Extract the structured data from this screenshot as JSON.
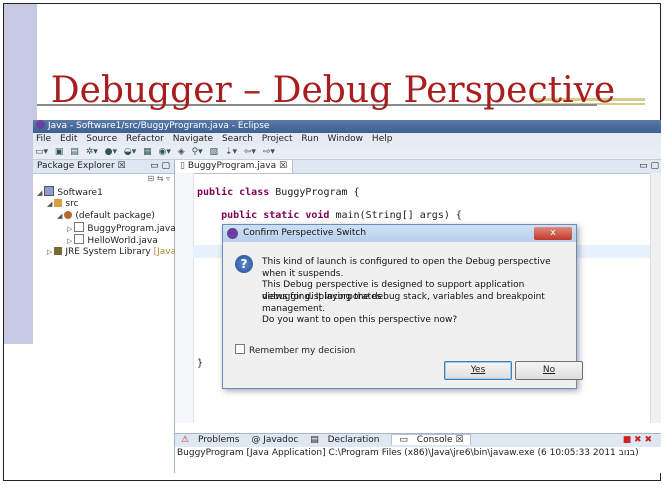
{
  "slide": {
    "title": "Debugger – Debug Perspective"
  },
  "window": {
    "title": "Java - Software1/src/BuggyProgram.java - Eclipse",
    "menu": [
      "File",
      "Edit",
      "Source",
      "Refactor",
      "Navigate",
      "Search",
      "Project",
      "Run",
      "Window",
      "Help"
    ]
  },
  "package_explorer": {
    "tab": "Package Explorer ☒",
    "tree": {
      "project": "Software1",
      "src": "src",
      "pkg": "(default package)",
      "file1": "BuggyProgram.java",
      "file2": "HelloWorld.java",
      "lib": "JRE System Library",
      "lib_suffix": "[JavaSE-"
    }
  },
  "editor": {
    "tab": "BuggyProgram.java ☒",
    "code": {
      "line1": "public class BuggyProgram {",
      "line2": "    public static void main(String[] args) {",
      "line3": "    }",
      "line4": "}"
    }
  },
  "bottom_panel": {
    "tabs": [
      "Problems",
      "@ Javadoc",
      "Declaration",
      "Console ☒"
    ],
    "status": "BuggyProgram [Java Application] C:\\Program Files (x86)\\Java\\jre6\\bin\\javaw.exe (6 10:05:33 2011 בנוב)"
  },
  "dialog": {
    "title": "Confirm Perspective Switch",
    "close": "x",
    "line1": "This kind of launch is configured to open the Debug perspective when it suspends.",
    "line2a": "This Debug perspective is designed to support application debugging.  It incorporates",
    "line2b": "views for displaying the debug stack, variables and breakpoint management.",
    "line3": "Do you want to open this perspective now?",
    "checkbox_label": "Remember my decision",
    "yes": "Yes",
    "no": "No"
  }
}
